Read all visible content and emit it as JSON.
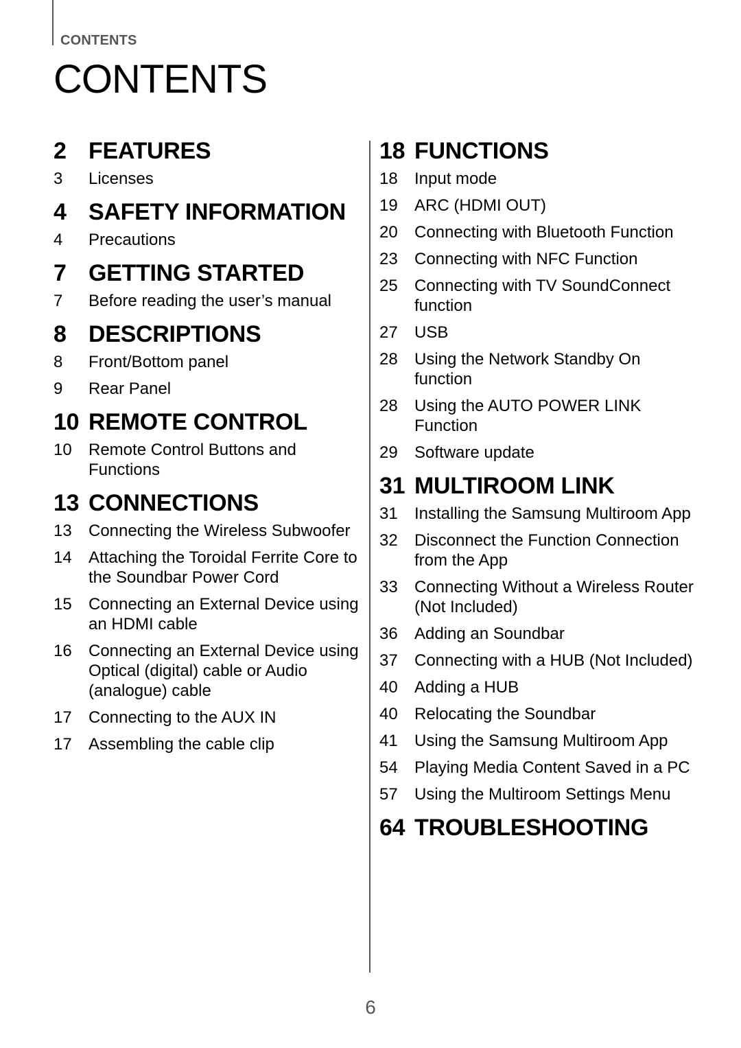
{
  "header": {
    "running_head": "CONTENTS",
    "title": "CONTENTS"
  },
  "left_column": [
    {
      "num": "2",
      "title": "FEATURES",
      "entries": [
        {
          "page": "3",
          "title": "Licenses"
        }
      ]
    },
    {
      "num": "4",
      "title": "SAFETY INFORMATION",
      "entries": [
        {
          "page": "4",
          "title": "Precautions"
        }
      ]
    },
    {
      "num": "7",
      "title": "GETTING STARTED",
      "entries": [
        {
          "page": "7",
          "title": "Before reading the user’s manual"
        }
      ]
    },
    {
      "num": "8",
      "title": "DESCRIPTIONS",
      "entries": [
        {
          "page": "8",
          "title": "Front/Bottom panel"
        },
        {
          "page": "9",
          "title": "Rear Panel"
        }
      ]
    },
    {
      "num": "10",
      "title": "REMOTE CONTROL",
      "entries": [
        {
          "page": "10",
          "title": "Remote Control Buttons and Functions"
        }
      ]
    },
    {
      "num": "13",
      "title": "CONNECTIONS",
      "entries": [
        {
          "page": "13",
          "title": "Connecting the Wireless Subwoofer"
        },
        {
          "page": "14",
          "title": "Attaching the Toroidal Ferrite Core to the Soundbar Power Cord"
        },
        {
          "page": "15",
          "title": "Connecting an External Device using an HDMI cable"
        },
        {
          "page": "16",
          "title": "Connecting an External Device using Optical (digital) cable or Audio (analogue) cable"
        },
        {
          "page": "17",
          "title": "Connecting to the AUX IN"
        },
        {
          "page": "17",
          "title": "Assembling the cable clip"
        }
      ]
    }
  ],
  "right_column": [
    {
      "num": "18",
      "title": "FUNCTIONS",
      "entries": [
        {
          "page": "18",
          "title": "Input mode"
        },
        {
          "page": "19",
          "title": "ARC (HDMI OUT)"
        },
        {
          "page": "20",
          "title": "Connecting with Bluetooth Function"
        },
        {
          "page": "23",
          "title": "Connecting with NFC Function"
        },
        {
          "page": "25",
          "title": "Connecting with TV SoundConnect function"
        },
        {
          "page": "27",
          "title": "USB"
        },
        {
          "page": "28",
          "title": "Using the Network Standby On function"
        },
        {
          "page": "28",
          "title": "Using the AUTO POWER LINK Function"
        },
        {
          "page": "29",
          "title": "Software update"
        }
      ]
    },
    {
      "num": "31",
      "title": "MULTIROOM LINK",
      "entries": [
        {
          "page": "31",
          "title": "Installing the Samsung Multiroom App"
        },
        {
          "page": "32",
          "title": "Disconnect the Function Connection from the App"
        },
        {
          "page": "33",
          "title": "Connecting Without a Wireless Router (Not Included)"
        },
        {
          "page": "36",
          "title": "Adding an Soundbar"
        },
        {
          "page": "37",
          "title": "Connecting with a HUB (Not Included)"
        },
        {
          "page": "40",
          "title": "Adding a HUB"
        },
        {
          "page": "40",
          "title": "Relocating the Soundbar"
        },
        {
          "page": "41",
          "title": "Using the Samsung Multiroom App"
        },
        {
          "page": "54",
          "title": "Playing Media Content Saved in a PC"
        },
        {
          "page": "57",
          "title": "Using the Multiroom Settings Menu"
        }
      ]
    },
    {
      "num": "64",
      "title": "TROUBLESHOOTING",
      "entries": []
    }
  ],
  "footer": {
    "page_number": "6"
  }
}
